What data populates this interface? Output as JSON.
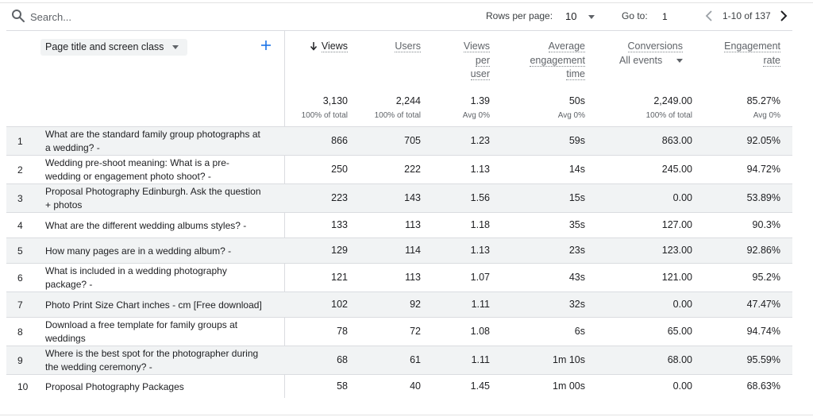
{
  "toolbar": {
    "search_placeholder": "Search...",
    "rows_per_page_label": "Rows per page:",
    "rows_per_page_value": "10",
    "goto_label": "Go to:",
    "goto_value": "1",
    "range_text": "1-10 of 137",
    "icons": {
      "search": "search-icon",
      "prev": "chevron-left-icon",
      "next": "chevron-right-icon",
      "dropdown": "caret-down-icon"
    }
  },
  "table": {
    "dimension_label": "Page title and screen class",
    "add_dimension_icon": "plus-icon",
    "sort_icon": "arrow-down-icon",
    "columns": {
      "views": {
        "label": "Views",
        "total": "3,130",
        "sub": "100% of total"
      },
      "users": {
        "label": "Users",
        "total": "2,244",
        "sub": "100% of total"
      },
      "views_per_user": {
        "label_lines": [
          "Views",
          "per",
          "user"
        ],
        "total": "1.39",
        "sub": "Avg 0%"
      },
      "avg_engagement": {
        "label_lines": [
          "Average",
          "engagement",
          "time"
        ],
        "total": "50s",
        "sub": "Avg 0%"
      },
      "conversions": {
        "label": "Conversions",
        "filter": "All events",
        "total": "2,249.00",
        "sub": "100% of total"
      },
      "engagement_rate": {
        "label_lines": [
          "Engagement",
          "rate"
        ],
        "total": "85.27%",
        "sub": "Avg 0%"
      }
    },
    "rows": [
      {
        "num": "1",
        "title_lines": [
          "What are the standard family group photographs at",
          "a wedding? -"
        ],
        "views": "866",
        "users": "705",
        "vpu": "1.23",
        "aet": "59s",
        "conv": "863.00",
        "er": "92.05%"
      },
      {
        "num": "2",
        "title_lines": [
          "Wedding pre-shoot meaning: What is a pre-",
          "wedding or engagement photo shoot? -"
        ],
        "views": "250",
        "users": "222",
        "vpu": "1.13",
        "aet": "14s",
        "conv": "245.00",
        "er": "94.72%"
      },
      {
        "num": "3",
        "title_lines": [
          "Proposal Photography Edinburgh. Ask the question",
          "+ photos"
        ],
        "views": "223",
        "users": "143",
        "vpu": "1.56",
        "aet": "15s",
        "conv": "0.00",
        "er": "53.89%"
      },
      {
        "num": "4",
        "title_lines": [
          "What are the different wedding albums styles? -"
        ],
        "views": "133",
        "users": "113",
        "vpu": "1.18",
        "aet": "35s",
        "conv": "127.00",
        "er": "90.3%"
      },
      {
        "num": "5",
        "title_lines": [
          "How many pages are in a wedding album? -"
        ],
        "views": "129",
        "users": "114",
        "vpu": "1.13",
        "aet": "23s",
        "conv": "123.00",
        "er": "92.86%"
      },
      {
        "num": "6",
        "title_lines": [
          "What is included in a wedding photography",
          "package? -"
        ],
        "views": "121",
        "users": "113",
        "vpu": "1.07",
        "aet": "43s",
        "conv": "121.00",
        "er": "95.2%"
      },
      {
        "num": "7",
        "title_lines": [
          "Photo Print Size Chart inches - cm [Free download]"
        ],
        "views": "102",
        "users": "92",
        "vpu": "1.11",
        "aet": "32s",
        "conv": "0.00",
        "er": "47.47%"
      },
      {
        "num": "8",
        "title_lines": [
          "Download a free template for family groups at",
          "weddings"
        ],
        "views": "78",
        "users": "72",
        "vpu": "1.08",
        "aet": "6s",
        "conv": "65.00",
        "er": "94.74%"
      },
      {
        "num": "9",
        "title_lines": [
          "Where is the best spot for the photographer during",
          "the wedding ceremony? -"
        ],
        "views": "68",
        "users": "61",
        "vpu": "1.11",
        "aet": "1m 10s",
        "conv": "68.00",
        "er": "95.59%"
      },
      {
        "num": "10",
        "title_lines": [
          "Proposal Photography Packages"
        ],
        "views": "58",
        "users": "40",
        "vpu": "1.45",
        "aet": "1m 00s",
        "conv": "0.00",
        "er": "68.63%"
      }
    ]
  }
}
